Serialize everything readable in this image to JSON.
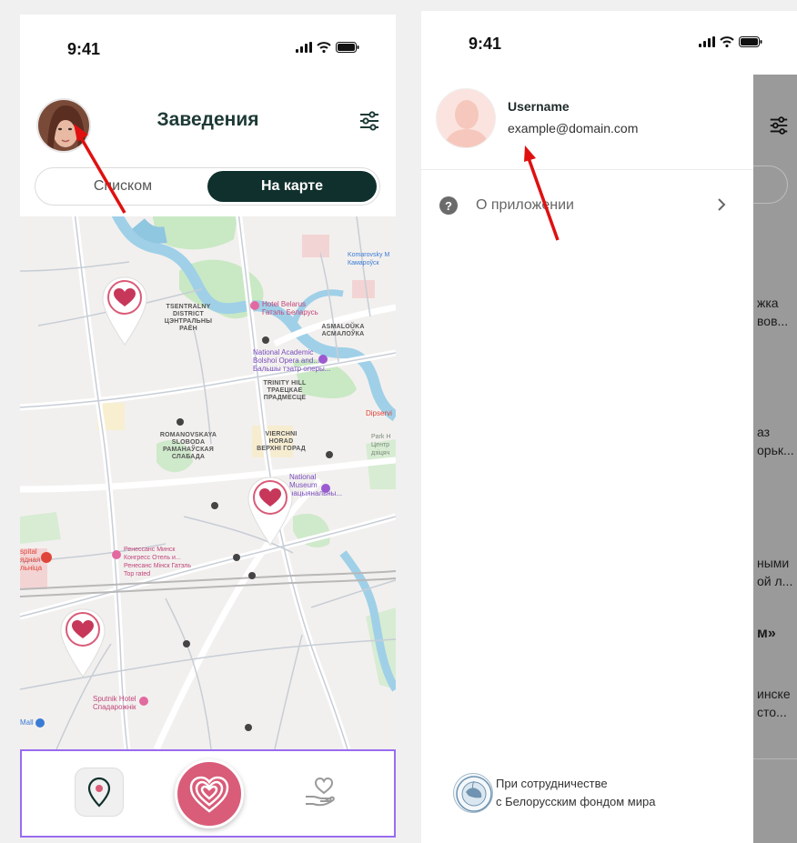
{
  "left_screen": {
    "time": "9:41",
    "title": "Заведения",
    "segment": {
      "list_label": "Списком",
      "map_label": "На карте"
    },
    "map_labels": {
      "tsentralny": "TSENTRALNY\nDISTRICT\nЦЭНТРАЛЬНЫ\nРАЁН",
      "asmalouka": "ASMALOŬKA\nАСМАЛОЎКА",
      "trinity": "TRINITY HILL\nТРАЕЦКАЕ\nПРАДМЕСЦЕ",
      "romanovskaya": "ROMANOVSKAYA\nSLOBODA\nРАМАНАЎСКАЯ\nСЛАБАДА",
      "vierchni": "VIERCHNI\nHORAD\nВЕРХНІ ГОРАД",
      "komarovsky": "Komarovsky M\nКамароўск"
    },
    "pois": {
      "hotel_belarus": "Hotel Belarus\nГатэль Беларусь",
      "opera": "National Academic\nBolshoi Opera and...\nБальшы тэатр оперы...",
      "museum": "National\nMuseum\nнацыянальны...",
      "renaissance": "Ренессанс Минск\nКонгресс Отель и...\nРенесанс Мінск Гатэль\nTop rated",
      "sputnik": "Sputnik Hotel\nСпадарожнік",
      "hospital": "spital\nядная\nльніца",
      "dipservice": "Dipservi",
      "park": "Park H\nЦентр\nдзіцяч",
      "mall": "Mall"
    }
  },
  "right_screen": {
    "time": "9:41",
    "profile": {
      "username": "Username",
      "email": "example@domain.com"
    },
    "menu": {
      "about_label": "О приложении"
    },
    "partner": {
      "line1": "При сотрудничестве",
      "line2": "с Белорусским фондом мира"
    },
    "overlay_fragments": [
      "жка",
      "вов...",
      "аз",
      "орьк...",
      "ными",
      "ой л...",
      "м»",
      "инске",
      "сто..."
    ]
  },
  "colors": {
    "accent_dark": "#10302d",
    "heart_pink": "#d95c78",
    "nav_outline": "#9a6cf0",
    "arrow_red": "#e01010"
  }
}
